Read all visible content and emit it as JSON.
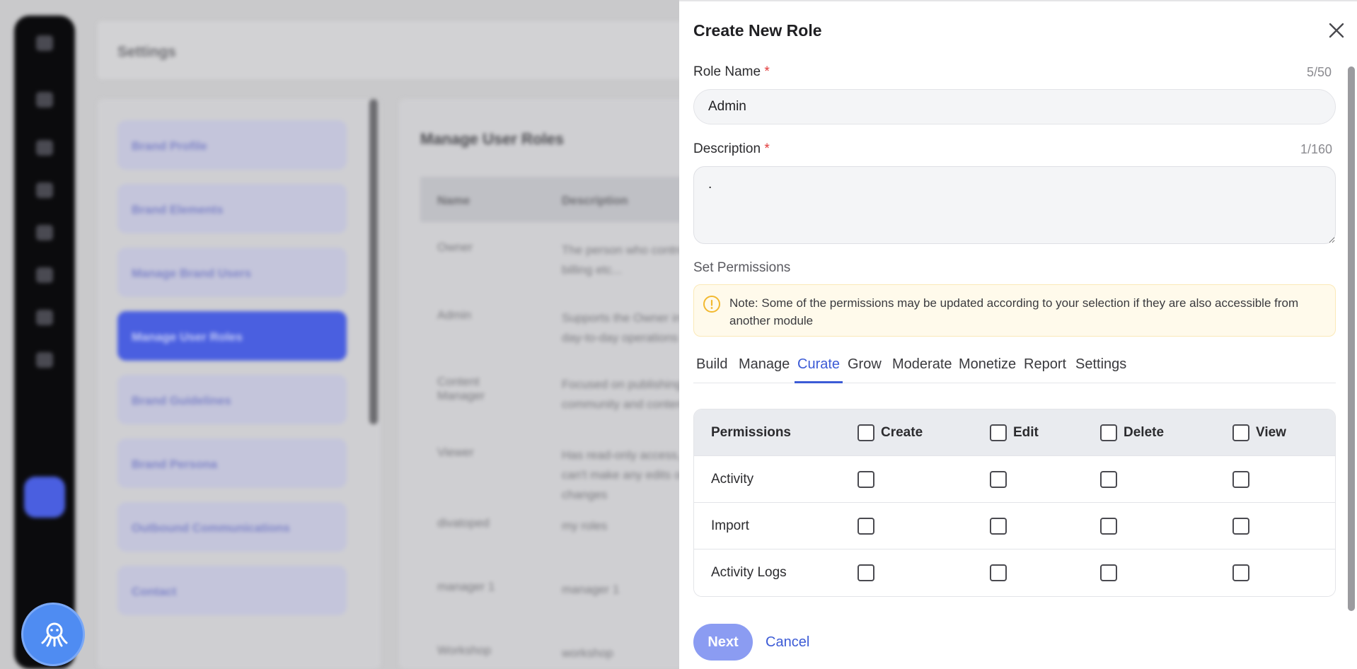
{
  "background": {
    "header_title": "Settings",
    "sidebar_items": [
      {
        "label": "Brand Profile"
      },
      {
        "label": "Brand Elements"
      },
      {
        "label": "Manage Brand Users"
      },
      {
        "label": "Manage User Roles"
      },
      {
        "label": "Brand Guidelines"
      },
      {
        "label": "Brand Persona"
      },
      {
        "label": "Outbound Communications"
      },
      {
        "label": "Contact"
      }
    ],
    "main_title": "Manage User Roles",
    "table_headers": {
      "name": "Name",
      "description": "Description"
    },
    "rows": [
      {
        "name": "Owner",
        "description": "The person who controls billing etc..."
      },
      {
        "name": "Admin",
        "description": "Supports the Owner in day-to-day operations"
      },
      {
        "name": "Content Manager",
        "description": "Focused on publishing community and content"
      },
      {
        "name": "Viewer",
        "description": "Has read-only access, can't make any edits or changes"
      },
      {
        "name": "divatoped",
        "description": "my roles"
      },
      {
        "name": "manager 1",
        "description": "manager 1"
      },
      {
        "name": "Workshop",
        "description": "workshop"
      }
    ]
  },
  "modal": {
    "title": "Create New Role",
    "role_name_label": "Role Name",
    "required_mark": "*",
    "role_name_counter": "5/50",
    "role_name_value": "Admin",
    "description_label": "Description",
    "description_counter": "1/160",
    "description_value": ".",
    "set_permissions_label": "Set Permissions",
    "note": "Note: Some of the permissions may be updated according to your selection if they are also accessible from another module",
    "tabs": [
      "Build",
      "Manage",
      "Curate",
      "Grow",
      "Moderate",
      "Monetize",
      "Report",
      "Settings"
    ],
    "active_tab": "Curate",
    "table_headers": {
      "permissions": "Permissions",
      "create": "Create",
      "edit": "Edit",
      "delete": "Delete",
      "view": "View"
    },
    "permission_rows": [
      {
        "label": "Activity"
      },
      {
        "label": "Import"
      },
      {
        "label": "Activity Logs"
      }
    ],
    "next_label": "Next",
    "cancel_label": "Cancel"
  },
  "colors": {
    "accent": "#3c5bd6",
    "next_button": "#8b9cf2",
    "note_bg": "#fffaeb",
    "required": "#e23b3b"
  }
}
